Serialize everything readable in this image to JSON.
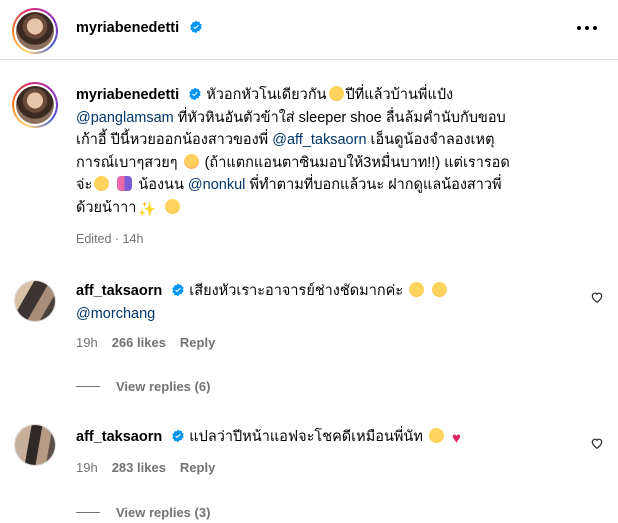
{
  "header": {
    "username": "myriabenedetti"
  },
  "post": {
    "username": "myriabenedetti",
    "caption_parts": [
      {
        "type": "text",
        "value": "หัวอกหัวโนเดียวกัน"
      },
      {
        "type": "emoji",
        "name": "smiling-face-emoji"
      },
      {
        "type": "text",
        "value": "ปีที่แล้วบ้านพี่แป๋ง"
      },
      {
        "type": "mention",
        "value": "@panglamsam"
      },
      {
        "type": "text",
        "value": "ที่หัวหินอันตัวข้าใส่ sleeper shoe ลื่นล้มคำนับกับขอบเก้าอี้ ปีนี้หวยออกน้องสาวของพี่"
      },
      {
        "type": "mention",
        "value": "@aff_taksaorn"
      },
      {
        "type": "text",
        "value": "เอ็นดูน้องจำลองเหตุการณ์เบาๆสวยๆ"
      },
      {
        "type": "emoji",
        "name": "kissing-face-emoji"
      },
      {
        "type": "text",
        "value": "(ถ้าแตกแอนตาซินมอบให้3หมื่นบาท!!) แต่เรารอดจ่ะ"
      },
      {
        "type": "emoji",
        "name": "yum-face-emoji"
      },
      {
        "type": "emoji",
        "name": "couple-emoji"
      },
      {
        "type": "text",
        "value": "น้องนน"
      },
      {
        "type": "mention",
        "value": "@nonkul"
      },
      {
        "type": "text",
        "value": "พี่ทำตามที่บอกแล้วนะ ฝากดูแลน้องสาวพี่ด้วยน้าาา"
      },
      {
        "type": "emoji",
        "name": "sparkles-emoji"
      },
      {
        "type": "emoji",
        "name": "hug-face-emoji"
      }
    ],
    "caption_line1": "หัวอกหัวโนเดียวกัน",
    "caption_line1b": "ปีที่แล้วบ้านพี่แป๋ง",
    "caption_mention1": "@panglamsam",
    "caption_line2": "ที่หัวหินอันตัวข้าใส่ sleeper shoe ลื่นล้มคำนับกับขอบ",
    "caption_line3a": "เก้าอี้ ปีนี้หวยออกน้องสาวของพี่",
    "caption_mention2": "@aff_taksaorn",
    "caption_line3b": "เอ็นดูน้องจำลองเหตุ",
    "caption_line4a": "การณ์เบาๆสวยๆ",
    "caption_line4b": "(ถ้าแตกแอนตาซินมอบให้3หมื่นบาท!!) แต่เรารอด",
    "caption_line5a": "จ่ะ",
    "caption_line5b": "น้องนน",
    "caption_mention3": "@nonkul",
    "caption_line5c": "พี่ทำตามที่บอกแล้วนะ ฝากดูแลน้องสาวพี่",
    "caption_line6": "ด้วยน้าาา",
    "meta": "Edited · 14h"
  },
  "comments": [
    {
      "username": "aff_taksaorn",
      "text": "เสียงหัวเราะอาจารย์ช่างชัดมากค่ะ",
      "mention": "@morchang",
      "time": "19h",
      "likes": "266 likes",
      "reply_label": "Reply",
      "view_replies": "View replies (6)"
    },
    {
      "username": "aff_taksaorn",
      "text": "แปลว่าปีหน้าแอฟจะโชคดีเหมือนพี่นัท",
      "time": "19h",
      "likes": "283 likes",
      "reply_label": "Reply",
      "view_replies": "View replies (3)"
    }
  ],
  "colors": {
    "mention": "#00376b",
    "meta": "#737373",
    "verified": "#0095f6",
    "divider": "#dbdbdb"
  }
}
